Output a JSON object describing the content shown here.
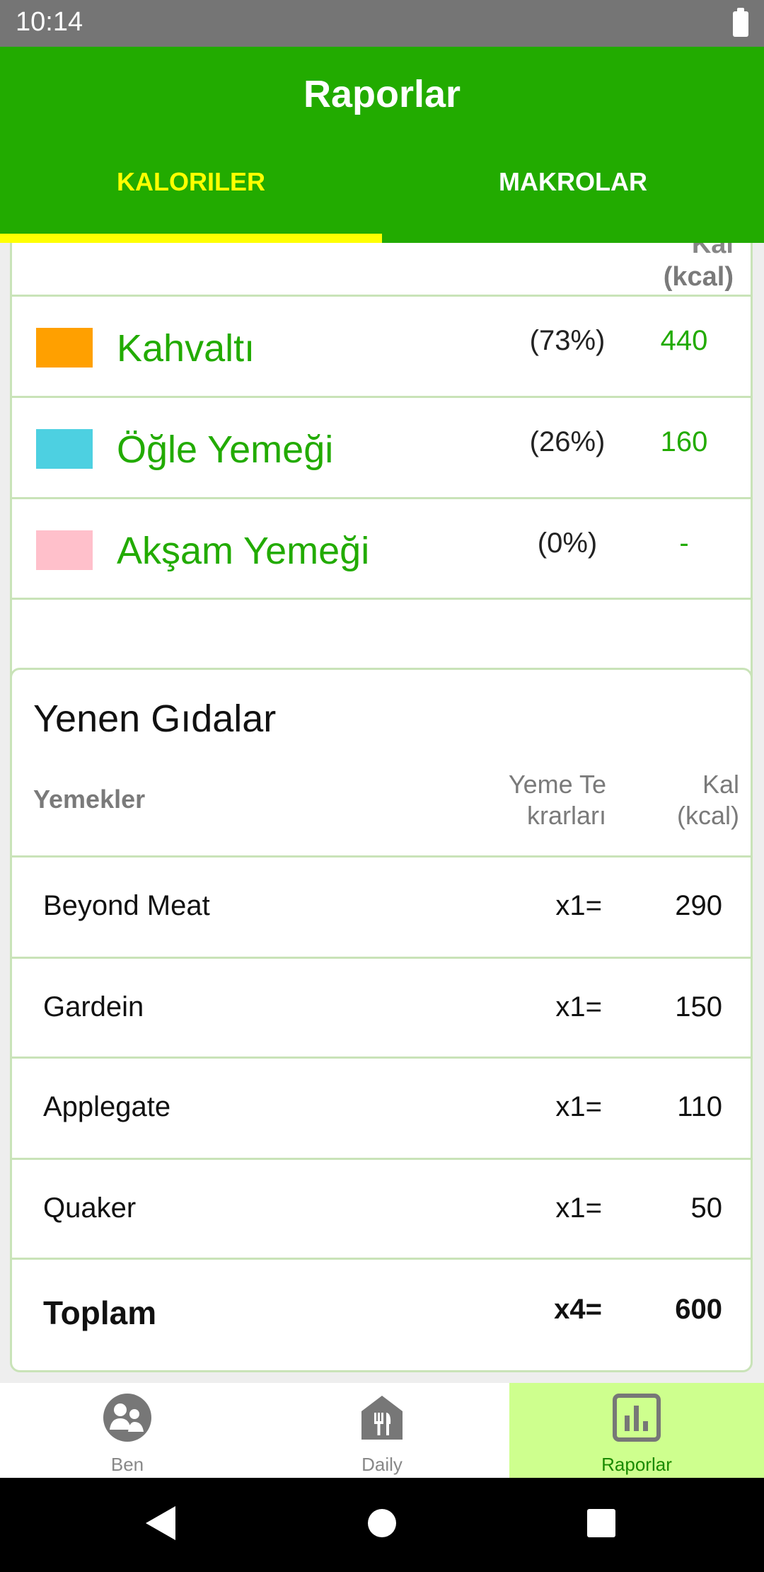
{
  "status": {
    "time": "10:14"
  },
  "appbar": {
    "title": "Raporlar",
    "tabs": [
      {
        "label": "KALORILER",
        "active": true
      },
      {
        "label": "MAKROLAR",
        "active": false
      }
    ]
  },
  "meals_card": {
    "header_partial": "Kal",
    "header_unit": "(kcal)",
    "meals": [
      {
        "name": "Kahvaltı",
        "percent": "(73%)",
        "calories": "440",
        "color": "#ffa000"
      },
      {
        "name": "Öğle Yemeği",
        "percent": "(26%)",
        "calories": "160",
        "color": "#4dd0e1"
      },
      {
        "name": "Akşam Yemeği",
        "percent": "(0%)",
        "calories": "-",
        "color": "#ffc0cb"
      }
    ]
  },
  "foods_card": {
    "title": "Yenen Gıdalar",
    "columns": {
      "name": "Yemekler",
      "qty_line1": "Yeme Te",
      "qty_line2": "krarları",
      "cal_line1": "Kal",
      "cal_line2": "(kcal)"
    },
    "rows": [
      {
        "name": "Beyond Meat",
        "qty": "x1=",
        "calories": "290"
      },
      {
        "name": "Gardein",
        "qty": "x1=",
        "calories": "150"
      },
      {
        "name": "Applegate",
        "qty": "x1=",
        "calories": "110"
      },
      {
        "name": "Quaker",
        "qty": "x1=",
        "calories": "50"
      }
    ],
    "total": {
      "name": "Toplam",
      "qty": "x4=",
      "calories": "600"
    }
  },
  "bottom_nav": [
    {
      "label": "Ben",
      "icon": "people-icon",
      "active": false
    },
    {
      "label": "Daily",
      "icon": "restaurant-house-icon",
      "active": false
    },
    {
      "label": "Raporlar",
      "icon": "bar-chart-icon",
      "active": true
    }
  ],
  "colors": {
    "primary": "#22ab00",
    "tab_active": "#ffff00",
    "nav_active_bg": "#ceff8e"
  }
}
